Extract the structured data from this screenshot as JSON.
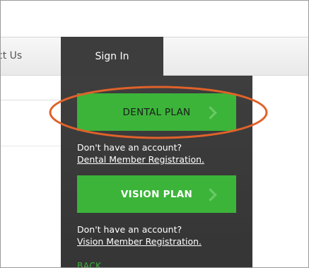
{
  "nav": {
    "contact_label": "ct Us",
    "signin_label": "Sign In"
  },
  "dropdown": {
    "dental_button": "DENTAL PLAN",
    "dental_prompt": "Don't have an account?",
    "dental_link": "Dental Member Registration.",
    "vision_button": "VISION PLAN",
    "vision_prompt": "Don't have an account?",
    "vision_link": "Vision Member Registration.",
    "back_label": "BACK"
  },
  "colors": {
    "accent_green": "#3cb43a",
    "dropdown_bg": "#3d3d3d",
    "highlight_ring": "#e0622a"
  },
  "icons": {
    "dental_chevron": "chevron-right-icon",
    "vision_chevron": "chevron-right-icon"
  }
}
